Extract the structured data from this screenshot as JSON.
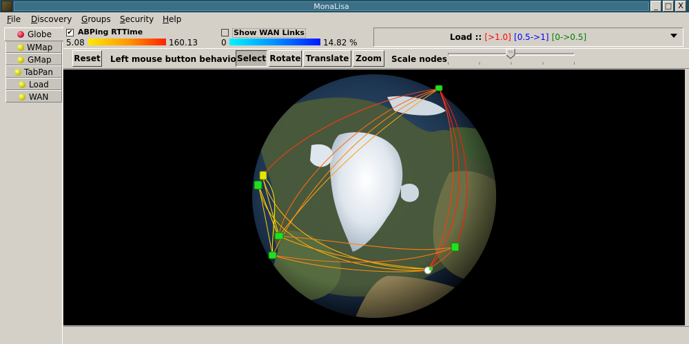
{
  "window": {
    "title": "MonaLisa",
    "minimize": "_",
    "maximize": "□",
    "close": "X"
  },
  "menu": [
    {
      "pre": "",
      "u": "F",
      "post": "ile"
    },
    {
      "pre": "",
      "u": "D",
      "post": "iscovery"
    },
    {
      "pre": "",
      "u": "G",
      "post": "roups"
    },
    {
      "pre": "",
      "u": "S",
      "post": "ecurity"
    },
    {
      "pre": "",
      "u": "H",
      "post": "elp"
    }
  ],
  "tabs": [
    {
      "label": "Globe",
      "active": true
    },
    {
      "label": "WMap"
    },
    {
      "label": "GMap"
    },
    {
      "label": "TabPan"
    },
    {
      "label": "Load"
    },
    {
      "label": "WAN"
    }
  ],
  "abping": {
    "checked": true,
    "label": "ABPing RTTime",
    "min": "5.08",
    "max": "160.13"
  },
  "wan": {
    "checked": false,
    "label": "Show WAN Links",
    "min": "0",
    "max": "14.82 %"
  },
  "load": {
    "prefix": "Load :: ",
    "high": "[>1.0]",
    "mid": "[0.5->1]",
    "low": "[0->0.5]",
    "colors": {
      "high": "#ff0000",
      "mid": "#0000ff",
      "low": "#008000"
    }
  },
  "toolbar": {
    "reset": "Reset",
    "behavior_label": "Left mouse button behavior:",
    "select": "Select",
    "rotate": "Rotate",
    "translate": "Translate",
    "zoom": "Zoom",
    "scale_label": "Scale nodes"
  },
  "scale_slider": {
    "value_fraction": 0.5
  },
  "colors": {
    "ping_low": "#ffe800",
    "ping_high": "#ff2200",
    "node": "#22dd22"
  }
}
